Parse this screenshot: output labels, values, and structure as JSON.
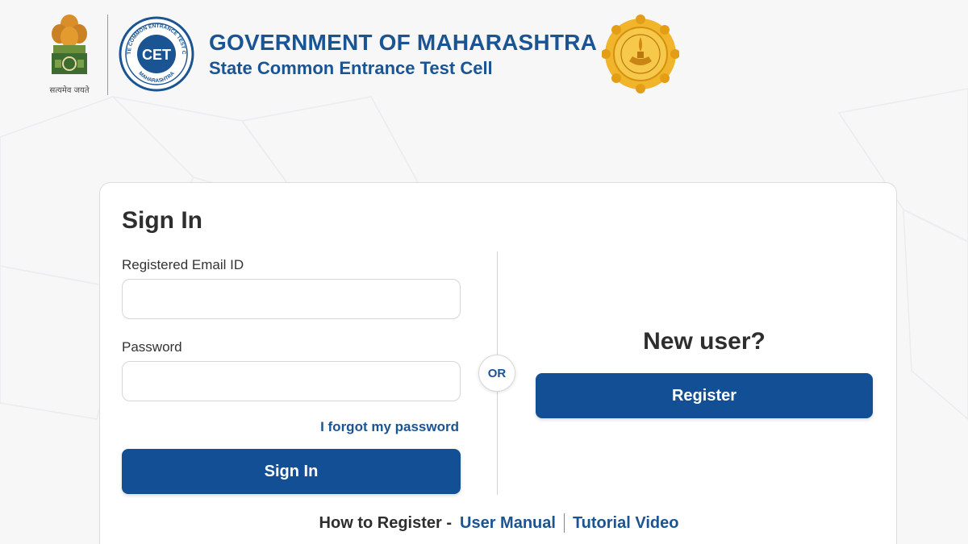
{
  "header": {
    "emblem_caption": "सत्यमेव जयते",
    "gov_title": "GOVERNMENT OF MAHARASHTRA",
    "cell_title": "State Common Entrance Test Cell",
    "cet_logo_text": "CET",
    "cet_logo_ring_text": "STATE COMMON ENTRANCE TEST CELL",
    "cet_logo_bottom_text": "MAHARASHTRA"
  },
  "signin": {
    "heading": "Sign In",
    "email_label": "Registered Email ID",
    "email_value": "",
    "email_placeholder": "",
    "password_label": "Password",
    "password_value": "",
    "password_placeholder": "",
    "forgot_label": "I forgot my password",
    "button_label": "Sign In"
  },
  "divider": {
    "or_label": "OR"
  },
  "register": {
    "heading": "New user?",
    "button_label": "Register"
  },
  "help": {
    "text": "How to Register -",
    "manual_label": "User Manual",
    "video_label": "Tutorial Video"
  },
  "colors": {
    "brand_blue": "#1a5493",
    "button_blue": "#134f95",
    "seal_gold": "#e9a91c"
  },
  "icons": [
    "ashoka-emblem-icon",
    "cet-logo-icon",
    "maharashtra-seal-icon"
  ]
}
